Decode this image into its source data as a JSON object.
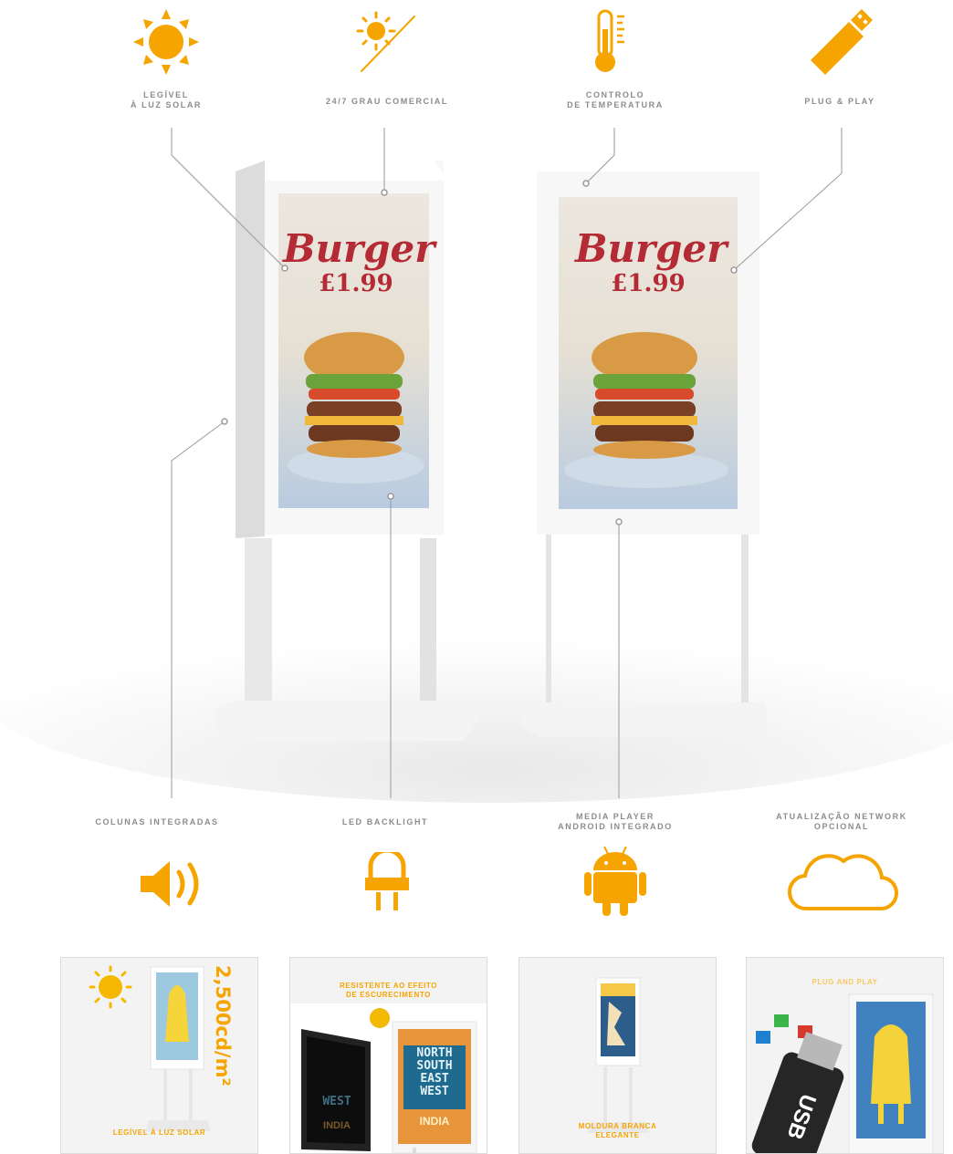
{
  "colors": {
    "accent": "#f5a400",
    "label_gray": "#8c8c8c",
    "screen_red": "#b52b35"
  },
  "top_features": [
    {
      "icon": "sun-icon",
      "label_line1": "LEGÍVEL",
      "label_line2": "À LUZ SOLAR"
    },
    {
      "icon": "sun-moon-icon",
      "label_line1": "24/7 GRAU COMERCIAL",
      "label_line2": ""
    },
    {
      "icon": "thermometer-icon",
      "label_line1": "CONTROLO",
      "label_line2": "DE TEMPERATURA"
    },
    {
      "icon": "usb-stick-icon",
      "label_line1": "PLUG & PLAY",
      "label_line2": ""
    }
  ],
  "bottom_features": [
    {
      "icon": "speaker-icon",
      "label_line1": "COLUNAS INTEGRADAS",
      "label_line2": ""
    },
    {
      "icon": "plug-icon",
      "label_line1": "LED BACKLIGHT",
      "label_line2": ""
    },
    {
      "icon": "android-icon",
      "label_line1": "MEDIA PLAYER",
      "label_line2": "ANDROID INTEGRADO"
    },
    {
      "icon": "cloud-icon",
      "label_line1": "ATUALIZAÇÃO NETWORK",
      "label_line2": "OPCIONAL"
    }
  ],
  "screen": {
    "title": "Burger",
    "price": "£1.99"
  },
  "cards": [
    {
      "caption_line1": "LEGÍVEL À LUZ SOLAR",
      "caption_line2": "",
      "vertical_text": "2,500cd/m²"
    },
    {
      "caption_line1": "RESISTENTE AO EFEITO",
      "caption_line2": "DE ESCURECIMENTO",
      "poster_lines": [
        "NORTH",
        "SOUTH",
        "EAST",
        "WEST"
      ],
      "poster_footer": "INDIA",
      "dark_poster_line": "WEST"
    },
    {
      "caption_line1": "MOLDURA BRANCA",
      "caption_line2": "ELEGANTE"
    },
    {
      "caption_line1": "PLUG AND PLAY",
      "caption_line2": "",
      "usb_text": "USB"
    }
  ]
}
